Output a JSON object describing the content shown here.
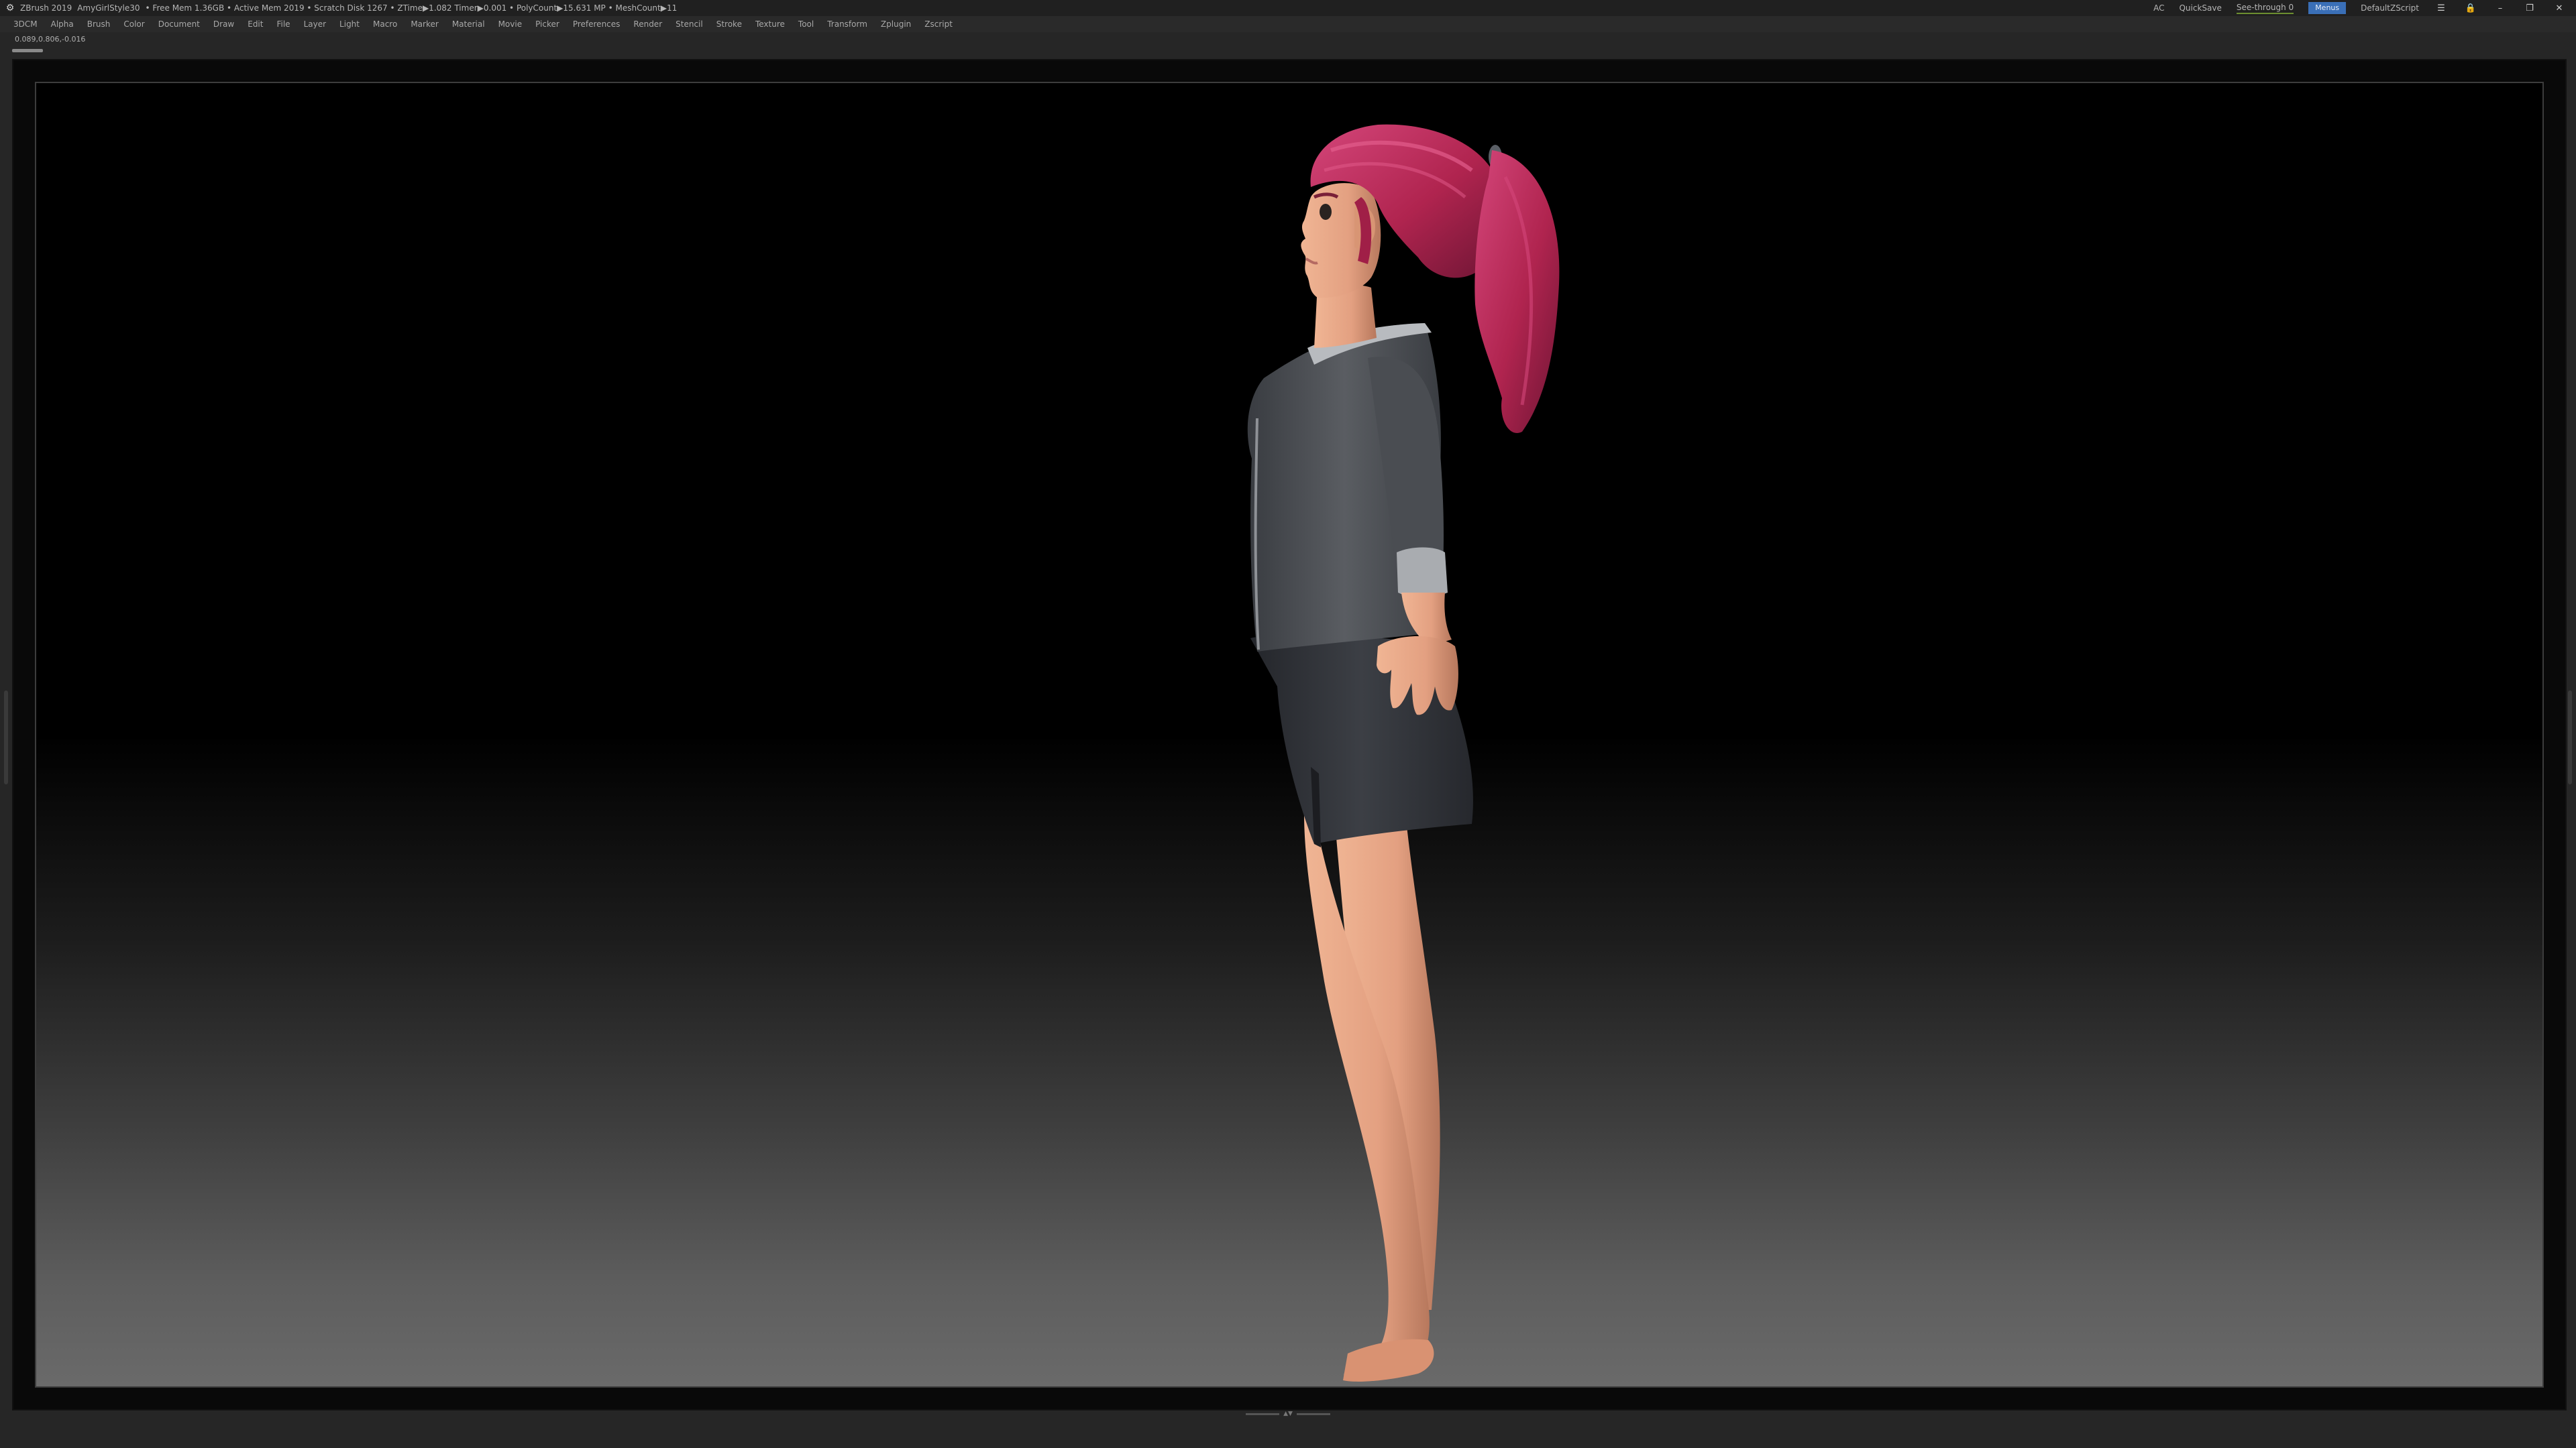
{
  "titlebar": {
    "app_name": "ZBrush 2019",
    "project": "AmyGirlStyle30",
    "stats": "• Free Mem 1.36GB • Active Mem 2019 • Scratch Disk 1267 • ZTime▶1.082 Timer▶0.001 • PolyCount▶15.631 MP • MeshCount▶11",
    "ac_label": "AC",
    "quicksave_label": "QuickSave",
    "see_through_label": "See-through 0",
    "menus_label": "Menus",
    "default_script_label": "DefaultZScript",
    "minimize_symbol": "–",
    "restore_symbol": "❐",
    "close_symbol": "✕"
  },
  "menubar": {
    "items": [
      "3DCM",
      "Alpha",
      "Brush",
      "Color",
      "Document",
      "Draw",
      "Edit",
      "File",
      "Layer",
      "Light",
      "Macro",
      "Marker",
      "Material",
      "Movie",
      "Picker",
      "Preferences",
      "Render",
      "Stencil",
      "Stroke",
      "Texture",
      "Tool",
      "Transform",
      "Zplugin",
      "Zscript"
    ]
  },
  "status": {
    "coordinates": "0.089,0.806,-0.016"
  },
  "colors": {
    "hair": "#b0244f",
    "hair_highlight": "#d4467a",
    "skin": "#e6a585",
    "skin_shadow": "#b7785d",
    "jacket": "#4f5257",
    "cuff": "#a9acb0",
    "skirt": "#34373d",
    "accent_menus": "#3a6fb7",
    "see_through_bar": "#6c8e2f"
  },
  "icons": [
    "zbrush-app-icon",
    "palette-icon",
    "lock-icon",
    "minimize-icon",
    "restore-icon",
    "close-icon"
  ]
}
